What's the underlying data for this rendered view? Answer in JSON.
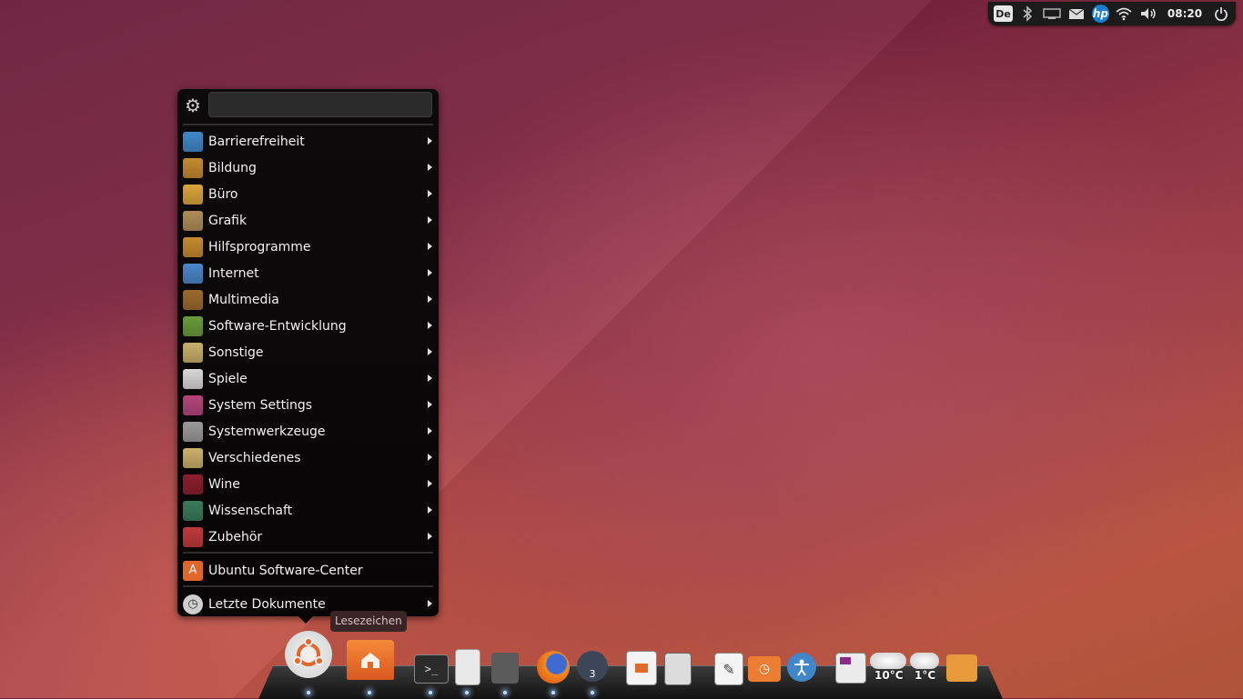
{
  "tray": {
    "keyboard_layout": "De",
    "clock": "08:20",
    "hp_label": "hp"
  },
  "menu": {
    "search_value": "",
    "categories": [
      {
        "label": "Barrierefreiheit",
        "icon": "accessibility-icon",
        "color": "#3f87c9"
      },
      {
        "label": "Bildung",
        "icon": "education-icon",
        "color": "#c48a2e"
      },
      {
        "label": "Büro",
        "icon": "office-icon",
        "color": "#d9a43a"
      },
      {
        "label": "Grafik",
        "icon": "graphics-icon",
        "color": "#b08d57"
      },
      {
        "label": "Hilfsprogramme",
        "icon": "utilities-icon",
        "color": "#c48a2e"
      },
      {
        "label": "Internet",
        "icon": "globe-icon",
        "color": "#4a86c8"
      },
      {
        "label": "Multimedia",
        "icon": "multimedia-icon",
        "color": "#9b6a2e"
      },
      {
        "label": "Software-Entwicklung",
        "icon": "development-icon",
        "color": "#6a9a3a"
      },
      {
        "label": "Sonstige",
        "icon": "other-icon",
        "color": "#c9b06a"
      },
      {
        "label": "Spiele",
        "icon": "games-icon",
        "color": "#d8d8d8"
      },
      {
        "label": "System Settings",
        "icon": "settings-icon",
        "color": "#b4457a"
      },
      {
        "label": "Systemwerkzeuge",
        "icon": "gear-icon",
        "color": "#9a9a9a"
      },
      {
        "label": "Verschiedenes",
        "icon": "misc-icon",
        "color": "#c9b06a"
      },
      {
        "label": "Wine",
        "icon": "wine-glass-icon",
        "color": "#8b1e2e"
      },
      {
        "label": "Wissenschaft",
        "icon": "science-icon",
        "color": "#3a7a5a"
      },
      {
        "label": "Zubehör",
        "icon": "accessories-icon",
        "color": "#c0393b"
      }
    ],
    "software_center": {
      "label": "Ubuntu Software-Center",
      "icon": "software-center-icon",
      "color": "#e0672b"
    },
    "recent": {
      "label": "Letzte Dokumente",
      "icon": "recent-documents-icon",
      "color": "#cfcfcf"
    }
  },
  "tooltip": "Lesezeichen",
  "dock": {
    "chat_badge": "3",
    "weather1": "10°C",
    "weather2": "1°C"
  }
}
